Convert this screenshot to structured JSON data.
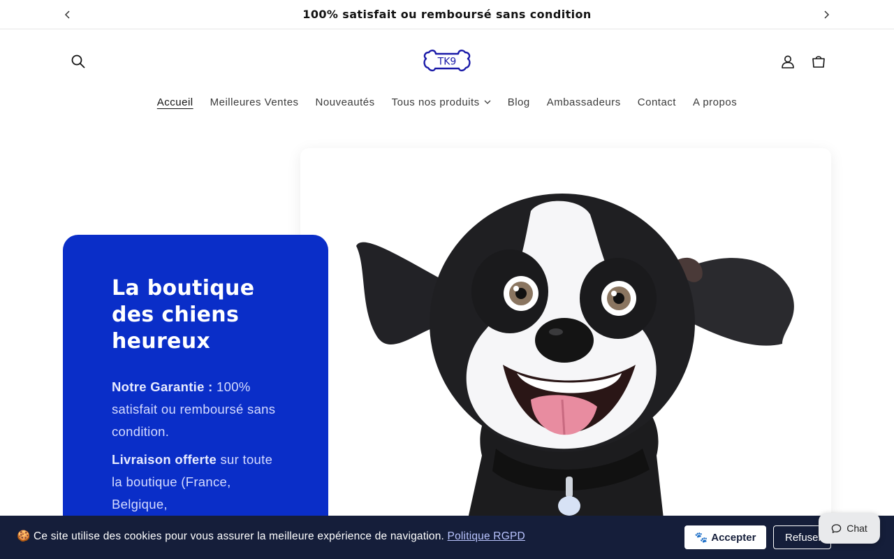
{
  "announcement": {
    "text": "100% satisfait ou remboursé sans condition",
    "prev_icon": "chevron-left-icon",
    "next_icon": "chevron-right-icon"
  },
  "header": {
    "logo_text": "TK9",
    "search_icon": "search-icon",
    "account_icon": "account-icon",
    "cart_icon": "cart-icon"
  },
  "nav": {
    "items": [
      {
        "label": "Accueil",
        "active": true
      },
      {
        "label": "Meilleures Ventes"
      },
      {
        "label": "Nouveautés"
      },
      {
        "label": "Tous nos produits",
        "has_dropdown": true
      },
      {
        "label": "Blog"
      },
      {
        "label": "Ambassadeurs"
      },
      {
        "label": "Contact"
      },
      {
        "label": "A propos"
      }
    ]
  },
  "hero": {
    "title": "La boutique des chiens heureux",
    "guarantee_label": "Notre Garantie :",
    "guarantee_text": " 100% satisfait ou remboursé sans condition.",
    "delivery_label": "Livraison offerte",
    "delivery_text": " sur toute la boutique (France, Belgique,",
    "card_color": "#0a2ec8"
  },
  "cookie_banner": {
    "emoji": "🍪",
    "text": " Ce site utilise des cookies pour vous assurer la meilleure expérience de navigation. ",
    "policy_link": "Politique RGPD",
    "accept_label": "Accepter",
    "accept_emoji": "🐾",
    "refuse_label": "Refuser"
  },
  "chat": {
    "label": "Chat",
    "icon": "chat-bubble-icon"
  },
  "colors": {
    "brand_blue": "#0a2ec8",
    "banner_bg": "#151e3a",
    "logo_blue": "#1a1aa8"
  }
}
